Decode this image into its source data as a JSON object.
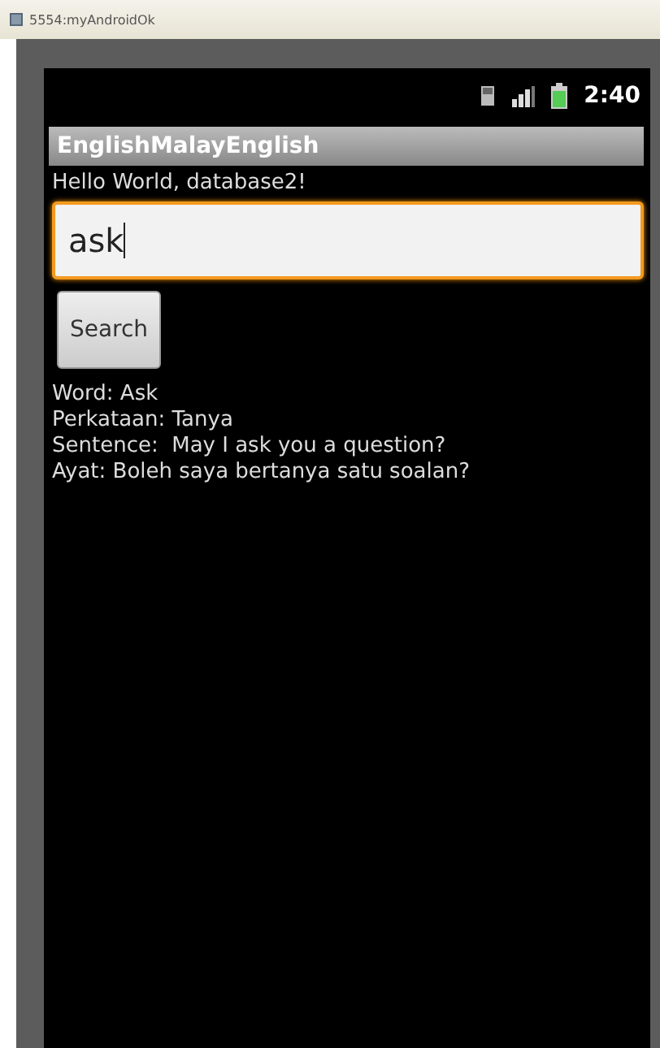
{
  "window": {
    "title": "5554:myAndroidOk"
  },
  "status_bar": {
    "time": "2:40"
  },
  "app_bar": {
    "title": "EnglishMalayEnglish"
  },
  "greeting": "Hello World, database2!",
  "search": {
    "value": "ask",
    "focused": true
  },
  "buttons": [
    {
      "label": "Search"
    }
  ],
  "results": [
    "Word: Ask",
    "Perkataan: Tanya",
    "Sentence:  May I ask you a question?",
    "Ayat: Boleh saya bertanya satu soalan?"
  ]
}
